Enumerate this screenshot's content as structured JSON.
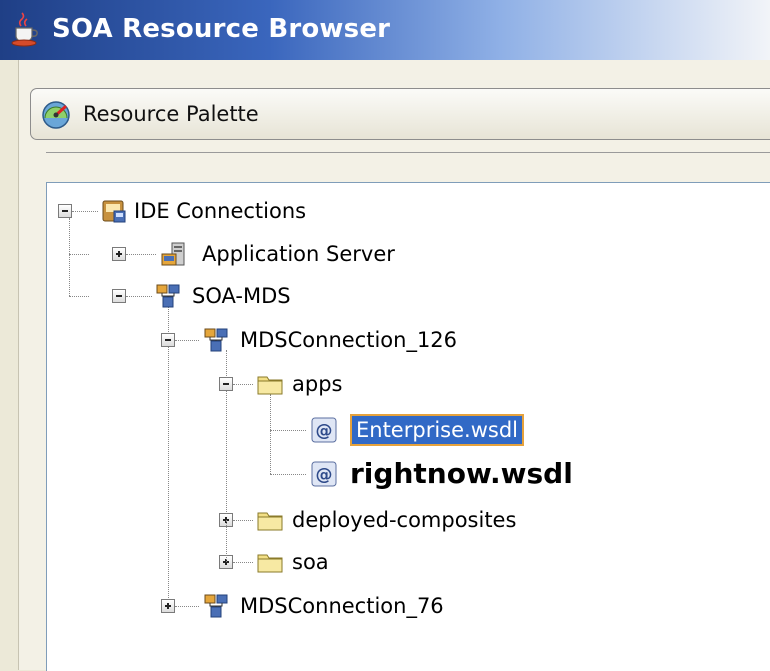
{
  "window": {
    "title": "SOA Resource Browser",
    "icon": "java-cup-icon"
  },
  "toolbar": {
    "palette_label": "Resource Palette",
    "palette_icon": "palette-gauge-icon"
  },
  "tree": {
    "root": {
      "label": "IDE Connections",
      "icon": "connections-book-icon",
      "expanded": true
    },
    "app_server": {
      "label": "Application Server",
      "icon": "server-icon",
      "expanded": false
    },
    "soa_mds": {
      "label": "SOA-MDS",
      "icon": "network-icon",
      "expanded": true
    },
    "mds126": {
      "label": "MDSConnection_126",
      "icon": "network-icon",
      "expanded": true
    },
    "apps": {
      "label": "apps",
      "icon": "folder-icon",
      "expanded": true
    },
    "enterprise_wsdl": {
      "label": "Enterprise.wsdl",
      "icon": "wsdl-at-icon",
      "selected": true
    },
    "rightnow_wsdl": {
      "label": "rightnow.wsdl",
      "icon": "wsdl-at-icon"
    },
    "deployed": {
      "label": "deployed-composites",
      "icon": "folder-icon",
      "expanded": false
    },
    "soa": {
      "label": "soa",
      "icon": "folder-icon",
      "expanded": false
    },
    "mds76": {
      "label": "MDSConnection_76",
      "icon": "network-icon",
      "expanded": false
    }
  },
  "colors": {
    "title_gradient_start": "#1f3f86",
    "selection": "#3169c6",
    "selection_outline": "#e6a23c"
  }
}
